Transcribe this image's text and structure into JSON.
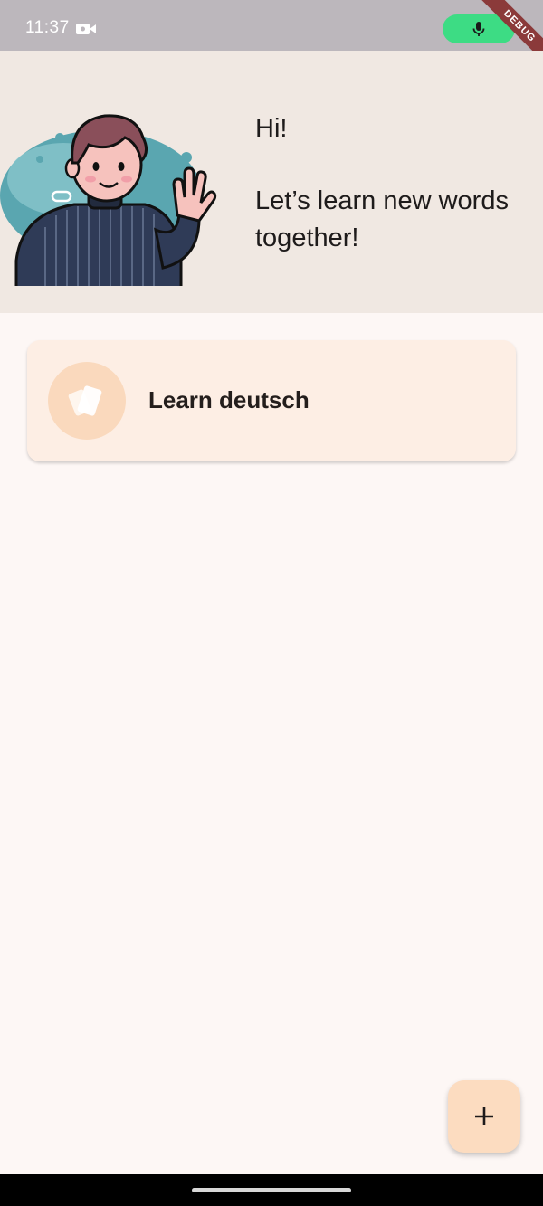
{
  "status_bar": {
    "time": "11:37",
    "camera_icon": "video-camera-icon",
    "mic_icon": "microphone-icon",
    "mic_color": "#3ddc84",
    "debug_label": "DEBUG"
  },
  "header": {
    "greeting": "Hi!",
    "subtitle": "Let’s learn new words together!",
    "background": "#f0e8e2",
    "avatar_icon": "waving-boy-illustration"
  },
  "decks": [
    {
      "title": "Learn deutsch",
      "icon": "cards-icon"
    }
  ],
  "fab": {
    "icon": "plus-icon",
    "background": "#fcdcc0"
  },
  "colors": {
    "page_background": "#fdf7f5",
    "card_background": "#fdeee4",
    "icon_circle": "#fad9bd"
  }
}
